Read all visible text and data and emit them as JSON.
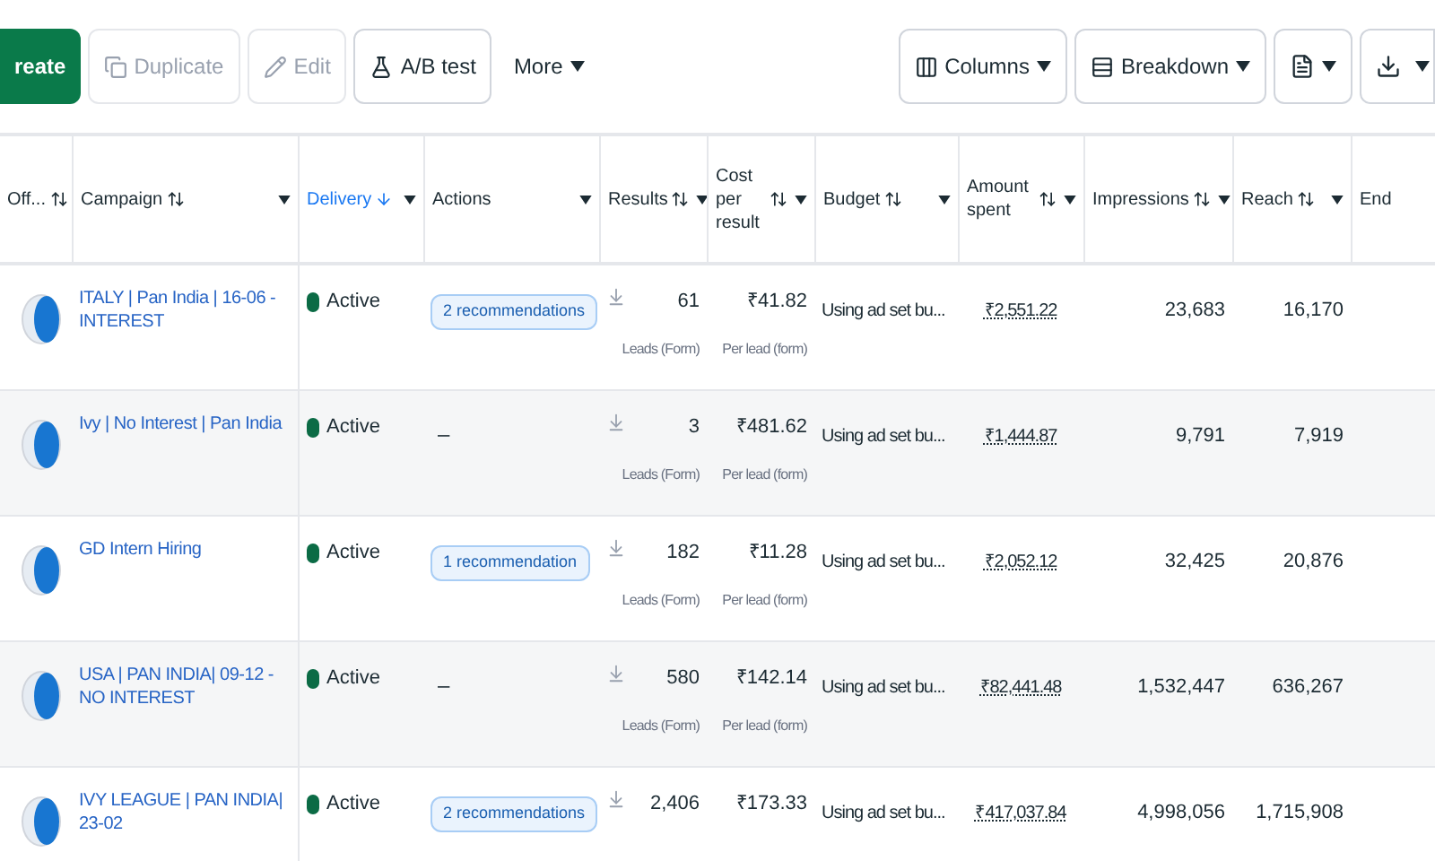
{
  "toolbar": {
    "left": [
      {
        "kind": "primary",
        "label": "reate",
        "disabled": false
      },
      {
        "kind": "duplicate",
        "label": "Duplicate",
        "disabled": true
      },
      {
        "kind": "edit",
        "label": "Edit",
        "disabled": true
      },
      {
        "kind": "abtest",
        "label": "A/B test",
        "disabled": false
      },
      {
        "kind": "more",
        "label": "More",
        "disabled": false
      }
    ],
    "right": [
      {
        "kind": "columns",
        "label": "Columns"
      },
      {
        "kind": "breakdown",
        "label": "Breakdown"
      },
      {
        "kind": "reports"
      },
      {
        "kind": "export"
      }
    ]
  },
  "table": {
    "columns": [
      {
        "label": "Off...",
        "sortable": true,
        "sorted": false,
        "menu": false
      },
      {
        "label": "Campaign",
        "sortable": true,
        "sorted": false,
        "menu": true
      },
      {
        "label": "Delivery",
        "sortable": true,
        "sorted": true,
        "menu": true
      },
      {
        "label": "Actions",
        "sortable": false,
        "sorted": false,
        "menu": true
      },
      {
        "label": "Results",
        "sortable": true,
        "sorted": false,
        "menu": true
      },
      {
        "label": "Cost per result",
        "sortable": true,
        "sorted": false,
        "menu": true
      },
      {
        "label": "Budget",
        "sortable": true,
        "sorted": false,
        "menu": true
      },
      {
        "label": "Amount spent",
        "sortable": true,
        "sorted": false,
        "menu": true
      },
      {
        "label": "Impressions",
        "sortable": true,
        "sorted": false,
        "menu": true
      },
      {
        "label": "Reach",
        "sortable": true,
        "sorted": false,
        "menu": true
      },
      {
        "label": "End",
        "sortable": false,
        "sorted": false,
        "menu": false
      }
    ],
    "rows": [
      {
        "on": true,
        "campaign": "ITALY | Pan India | 16-06 -INTEREST",
        "delivery": {
          "label": "Active",
          "color": "#0b6b45"
        },
        "action": {
          "kind": "recommendation",
          "label": "2 recommendations"
        },
        "results": "61",
        "results_note": "Leads (Form)",
        "cost": "₹41.82",
        "cost_note": "Per lead (form)",
        "budget": "Using ad set bu...",
        "spent": "₹2,551.22",
        "impressions": "23,683",
        "reach": "16,170"
      },
      {
        "on": true,
        "campaign": "Ivy | No Interest | Pan India",
        "delivery": {
          "label": "Active",
          "color": "#0b6b45"
        },
        "action": {
          "kind": "dash",
          "label": "–"
        },
        "results": "3",
        "results_note": "Leads (Form)",
        "cost": "₹481.62",
        "cost_note": "Per lead (form)",
        "budget": "Using ad set bu...",
        "spent": "₹1,444.87",
        "impressions": "9,791",
        "reach": "7,919"
      },
      {
        "on": true,
        "campaign": "GD Intern Hiring",
        "delivery": {
          "label": "Active",
          "color": "#0b6b45"
        },
        "action": {
          "kind": "recommendation",
          "label": "1 recommendation"
        },
        "results": "182",
        "results_note": "Leads (Form)",
        "cost": "₹11.28",
        "cost_note": "Per lead (form)",
        "budget": "Using ad set bu...",
        "spent": "₹2,052.12",
        "impressions": "32,425",
        "reach": "20,876"
      },
      {
        "on": true,
        "campaign": "USA | PAN INDIA| 09-12 - NO INTEREST",
        "delivery": {
          "label": "Active",
          "color": "#0b6b45"
        },
        "action": {
          "kind": "dash",
          "label": "–"
        },
        "results": "580",
        "results_note": "Leads (Form)",
        "cost": "₹142.14",
        "cost_note": "Per lead (form)",
        "budget": "Using ad set bu...",
        "spent": "₹82,441.48",
        "impressions": "1,532,447",
        "reach": "636,267"
      },
      {
        "on": true,
        "campaign": "IVY LEAGUE | PAN INDIA| 23-02",
        "delivery": {
          "label": "Active",
          "color": "#0b6b45"
        },
        "action": {
          "kind": "recommendation",
          "label": "2 recommendations"
        },
        "results": "2,406",
        "cost": "₹173.33",
        "budget": "Using ad set bu...",
        "spent": "₹417,037.84",
        "impressions": "4,998,056",
        "reach": "1,715,908"
      }
    ]
  }
}
